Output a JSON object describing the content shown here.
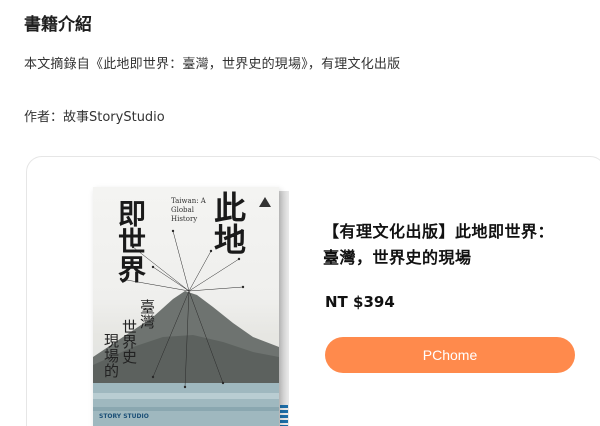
{
  "section": {
    "heading": "書籍介紹"
  },
  "excerpt": "本文摘錄自《此地即世界：臺灣，世界史的現場》，有理文化出版",
  "author_line": "作者：故事StoryStudio",
  "product": {
    "title": "【有理文化出版】此地即世界：臺灣，世界史的現場",
    "price": "NT $394",
    "button_label": "PChome"
  },
  "cover": {
    "title_right": "此地",
    "title_left": "即世界",
    "subtitle_1": "臺灣",
    "subtitle_2": "世界史",
    "subtitle_3": "現場的",
    "english": "Taiwan: A Global History",
    "publisher": "STORY STUDIO"
  },
  "colors": {
    "accent": "#ff8a4c",
    "card_border": "#e6e6e6"
  }
}
